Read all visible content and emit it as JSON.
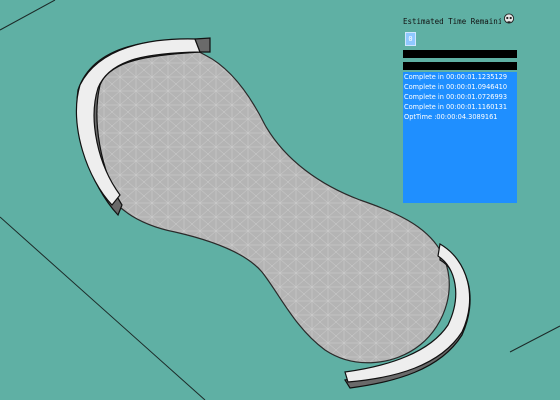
{
  "panel": {
    "title": "Estimated Time Remaini",
    "counter": "0",
    "icon": "skull-icon",
    "log": [
      "Complete in 00:00:01.1235129",
      "Complete in 00:00:01.0946410",
      "Complete in 00:00:01.0726993",
      "Complete in 00:00:01.1160131",
      "OptTime :00:00:04.3089161"
    ]
  },
  "colors": {
    "background": "#5fb0a4",
    "panel": "#1f8fff",
    "mesh_fill": "#b4b4b4",
    "mesh_lines": "#d2d2d2",
    "wall_top": "#eeeeee",
    "wall_side": "#6a6a6a"
  }
}
